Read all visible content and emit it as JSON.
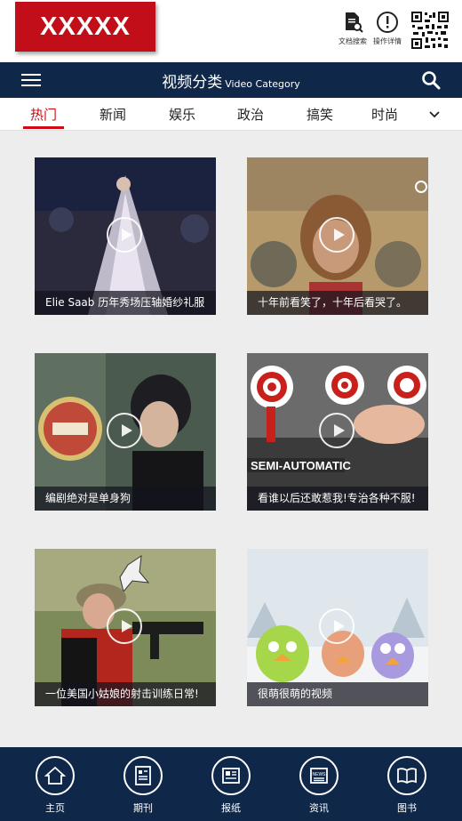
{
  "header": {
    "logo_text": "XXXXX",
    "tools": [
      {
        "label": "文档搜索",
        "icon": "doc-search-icon"
      },
      {
        "label": "操作详情",
        "icon": "info-icon"
      }
    ],
    "qr_icon": "qr-code-icon"
  },
  "navbar": {
    "title_cn": "视频分类",
    "title_en": "Video Category",
    "menu_icon": "hamburger-icon",
    "search_icon": "search-icon"
  },
  "tabs": {
    "items": [
      "热门",
      "新闻",
      "娱乐",
      "政治",
      "搞笑",
      "时尚"
    ],
    "active": "热门",
    "more_icon": "chevron-down-icon"
  },
  "videos": [
    {
      "caption": "Elie Saab 历年秀场压轴婚纱礼服"
    },
    {
      "caption": "十年前看笑了，十年后看哭了。"
    },
    {
      "caption": "编剧绝对是单身狗"
    },
    {
      "caption": "看谁以后还敢惹我!专治各种不服!"
    },
    {
      "caption": "一位美国小姑娘的射击训练日常!"
    },
    {
      "caption": "很萌很萌的视频"
    }
  ],
  "footer": {
    "items": [
      {
        "label": "主页",
        "icon": "home-icon"
      },
      {
        "label": "期刊",
        "icon": "journal-icon"
      },
      {
        "label": "报纸",
        "icon": "newspaper-icon"
      },
      {
        "label": "资讯",
        "icon": "news-icon"
      },
      {
        "label": "图书",
        "icon": "book-icon"
      }
    ]
  },
  "colors": {
    "brand_red": "#c10e18",
    "nav_navy": "#0f2749",
    "active_tab": "#d00a14"
  }
}
